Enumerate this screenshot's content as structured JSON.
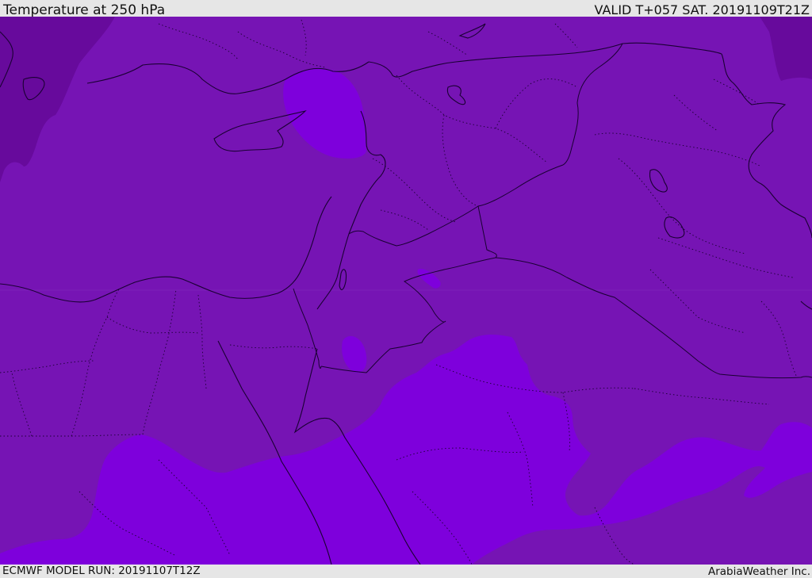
{
  "header": {
    "title": "Temperature at 250 hPa",
    "valid": "VALID T+057 SAT. 20191109T21Z"
  },
  "footer": {
    "model_run": "ECMWF MODEL RUN: 20191107T12Z",
    "credit": "ArabiaWeather Inc."
  },
  "map": {
    "field": "temperature",
    "level": "250 hPa",
    "colors": {
      "base": "#7614b4",
      "warm": "#7e00dc",
      "cold": "#670a9c",
      "coast": "#1a0033",
      "border": "#2a0044"
    }
  }
}
